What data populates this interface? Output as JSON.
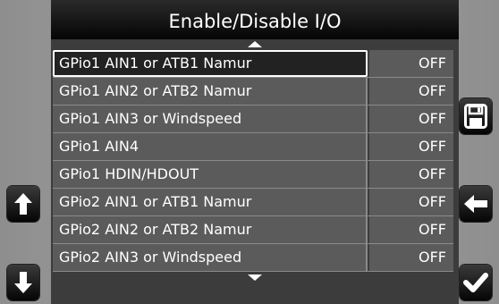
{
  "window": {
    "title": "Enable/Disable I/O"
  },
  "list": {
    "items": [
      {
        "label": "GPio1 AIN1 or ATB1 Namur",
        "value": "OFF"
      },
      {
        "label": "GPio1 AIN2 or ATB2 Namur",
        "value": "OFF"
      },
      {
        "label": "GPio1 AIN3 or Windspeed",
        "value": "OFF"
      },
      {
        "label": "GPio1 AIN4",
        "value": "OFF"
      },
      {
        "label": "GPio1 HDIN/HDOUT",
        "value": "OFF"
      },
      {
        "label": "GPio2 AIN1 or ATB1 Namur",
        "value": "OFF"
      },
      {
        "label": "GPio2 AIN2 or ATB2 Namur",
        "value": "OFF"
      },
      {
        "label": "GPio2 AIN3 or Windspeed",
        "value": "OFF"
      }
    ]
  },
  "icons": {
    "scroll_up": "arrow-up-icon",
    "scroll_down": "arrow-down-icon",
    "save": "floppy-disk-icon",
    "back": "arrow-left-icon",
    "confirm": "checkmark-icon"
  },
  "colors": {
    "title_bar": "#000000",
    "row_background": "#5b5b5b",
    "selected_row": "#222222",
    "text": "#ffffff",
    "screen_background": "#9a9a9a"
  }
}
